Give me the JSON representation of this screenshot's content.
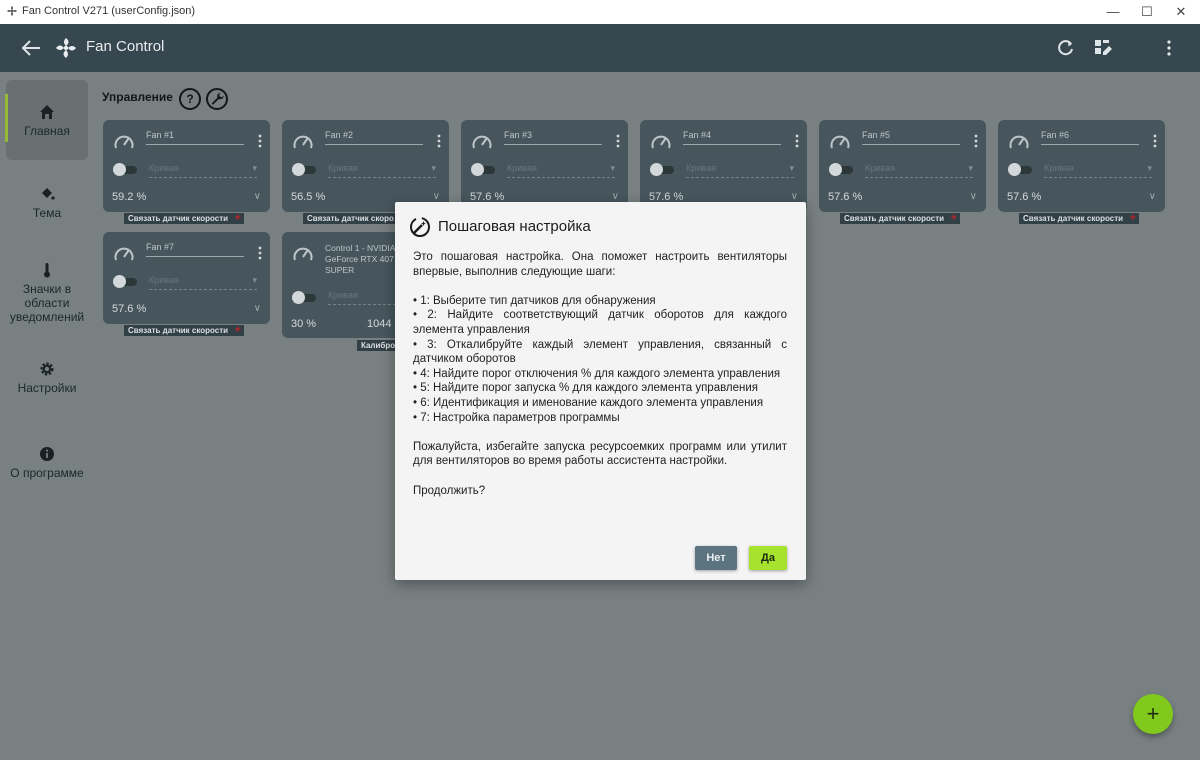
{
  "window": {
    "title": "Fan Control V271 (userConfig.json)",
    "minimize": "—",
    "maximize": "☐",
    "close": "✕"
  },
  "appbar": {
    "title": "Fan Control"
  },
  "sidebar": {
    "items": [
      {
        "label": "Главная",
        "icon": "home-icon",
        "active": true
      },
      {
        "label": "Тема",
        "icon": "paint-bucket-icon"
      },
      {
        "label": "Значки в области уведомлений",
        "icon": "thermometer-icon"
      },
      {
        "label": "Настройки",
        "icon": "gear-icon"
      },
      {
        "label": "О программе",
        "icon": "info-icon"
      }
    ]
  },
  "section": {
    "title": "Управление",
    "help": "?"
  },
  "cards": [
    {
      "name": "Fan #1",
      "mode": "Кривая",
      "value": "59.2 %",
      "chip": "Связать датчик скорости"
    },
    {
      "name": "Fan #2",
      "mode": "Кривая",
      "value": "56.5 %",
      "chip": "Связать датчик скоро"
    },
    {
      "name": "Fan #3",
      "mode": "Кривая",
      "value": "57.6 %"
    },
    {
      "name": "Fan #4",
      "mode": "Кривая",
      "value": "57.6 %"
    },
    {
      "name": "Fan #5",
      "mode": "Кривая",
      "value": "57.6 %",
      "chip": "Связать датчик скорости"
    },
    {
      "name": "Fan #6",
      "mode": "Кривая",
      "value": "57.6 %",
      "chip": "Связать датчик скорости"
    },
    {
      "name": "Fan #7",
      "mode": "Кривая",
      "value": "57.6 %",
      "chip": "Связать датчик скорости"
    },
    {
      "name_lines": [
        "Control 1 - NVIDIA",
        "GeForce RTX 407",
        "SUPER"
      ],
      "mode": "Кривая",
      "value": "30 %",
      "rpm": "1044",
      "chip": "Калибро"
    }
  ],
  "dialog": {
    "title": "Пошаговая настройка",
    "intro": "Это пошаговая настройка. Она поможет настроить вентиляторы впервые, выполнив следующие шаги:",
    "steps": [
      "• 1: Выберите тип датчиков для обнаружения",
      "• 2: Найдите соответствующий датчик оборотов для каждого элемента управления",
      "• 3: Откалибруйте каждый элемент управления, связанный с датчиком оборотов",
      "• 4: Найдите порог отключения % для каждого элемента управления",
      "• 5: Найдите порог запуска % для каждого элемента управления",
      "• 6: Идентификация и именование каждого элемента управления",
      "• 7: Настройка параметров программы"
    ],
    "warning": "Пожалуйста, избегайте запуска ресурсоемких программ или утилит для вентиляторов во время работы ассистента настройки.",
    "question": "Продолжить?",
    "no_label": "Нет",
    "yes_label": "Да"
  },
  "fab": {
    "label": "+"
  },
  "colors": {
    "appbar": "#37474f",
    "card": "#4b5b62",
    "accent": "#a6e22e",
    "background": "#7f8789"
  }
}
